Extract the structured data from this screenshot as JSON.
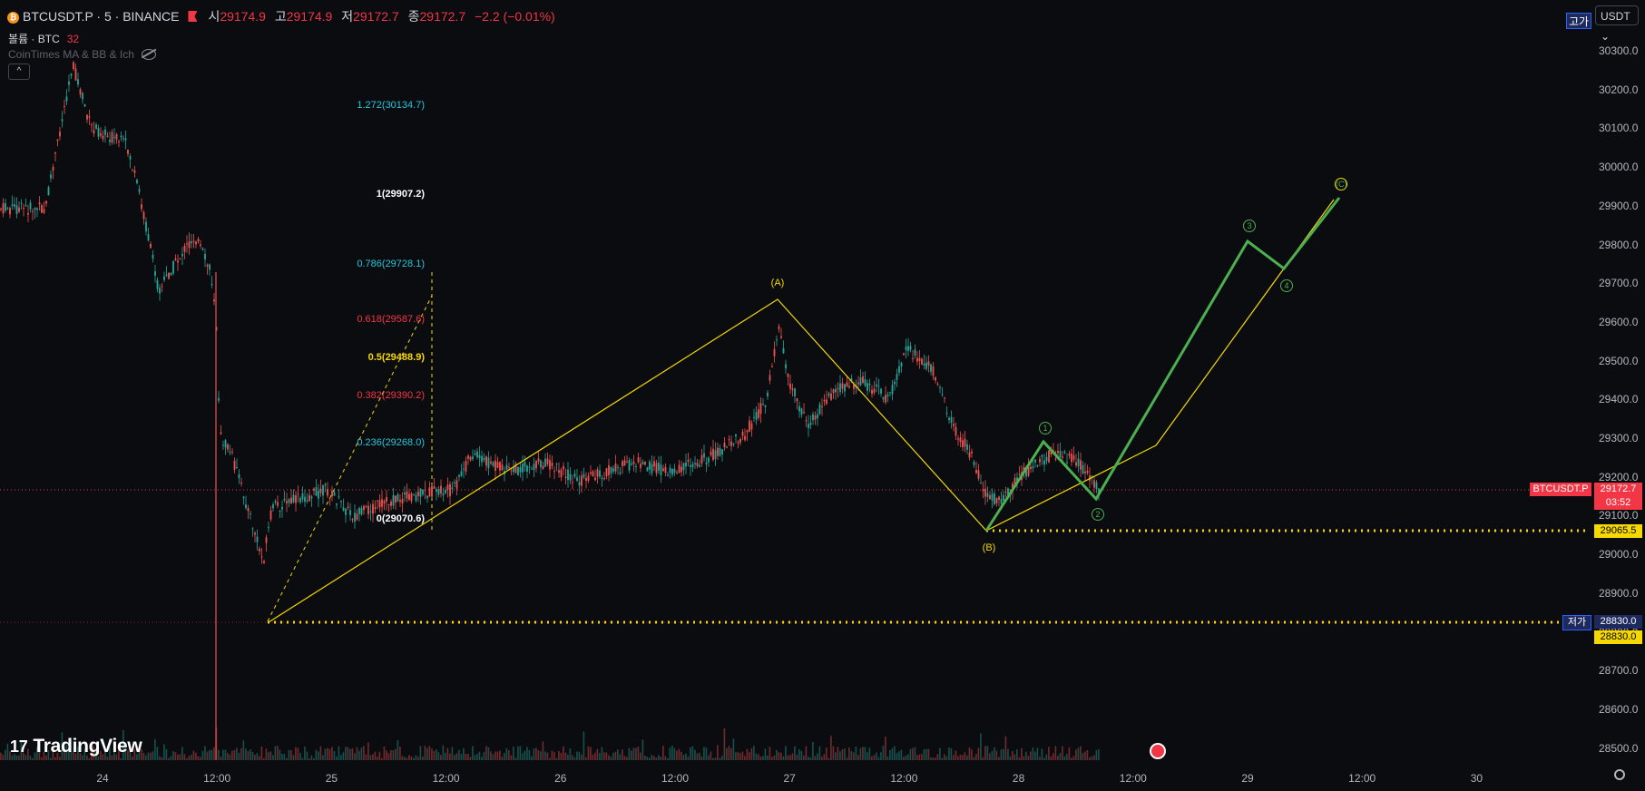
{
  "header": {
    "symbol": "BTCUSDT.P · 5 · BINANCE",
    "open_label": "시",
    "open": "29174.9",
    "high_label": "고",
    "high": "29174.9",
    "low_label": "저",
    "low": "29172.7",
    "close_label": "종",
    "close": "29172.7",
    "change": "−2.2 (−0.01%)"
  },
  "volume_row": {
    "label": "볼륨 · BTC",
    "value": "32"
  },
  "indicator_row": {
    "label": "CoinTimes MA & BB & Ich"
  },
  "collapse": {
    "glyph": "^"
  },
  "currency": {
    "label": "USDT"
  },
  "high_tag": {
    "label": "고가"
  },
  "low_tag": {
    "label": "저가"
  },
  "price_axis": [
    "30300.0",
    "30200.0",
    "30100.0",
    "30000.0",
    "29900.0",
    "29800.0",
    "29700.0",
    "29600.0",
    "29500.0",
    "29400.0",
    "29300.0",
    "29200.0",
    "29100.0",
    "29000.0",
    "28900.0",
    "28800.0",
    "28700.0",
    "28600.0",
    "28500.0"
  ],
  "time_axis": [
    "24",
    "12:00",
    "25",
    "12:00",
    "26",
    "12:00",
    "27",
    "12:00",
    "28",
    "12:00",
    "29",
    "12:00",
    "30"
  ],
  "tags": {
    "symbol_tag": "BTCUSDT.P",
    "last_price": "29172.7",
    "countdown": "03:52",
    "level_b": "29065.5",
    "level_low": "28830.0",
    "level_low2": "28830.0"
  },
  "fib_levels": [
    {
      "label": "1.272(30134.7)",
      "color": "#26c6da"
    },
    {
      "label": "1(29907.2)",
      "color": "#ffffff"
    },
    {
      "label": "0.786(29728.1)",
      "color": "#26c6da"
    },
    {
      "label": "0.618(29587.6)",
      "color": "#f23645"
    },
    {
      "label": "0.5(29488.9)",
      "color": "#f5d800"
    },
    {
      "label": "0.382(29390.2)",
      "color": "#f23645"
    },
    {
      "label": "0.236(29268.0)",
      "color": "#26c6da"
    },
    {
      "label": "0(29070.6)",
      "color": "#ffffff"
    }
  ],
  "waves": {
    "A": "(A)",
    "B": "(B)",
    "C": "(C)"
  },
  "wave_numbers": [
    "1",
    "2",
    "3",
    "4"
  ],
  "logo": {
    "text": "TradingView"
  },
  "colors": {
    "up": "#26a69a",
    "down": "#ef5350",
    "wave": "#f5d800",
    "projection": "#4caf50"
  }
}
